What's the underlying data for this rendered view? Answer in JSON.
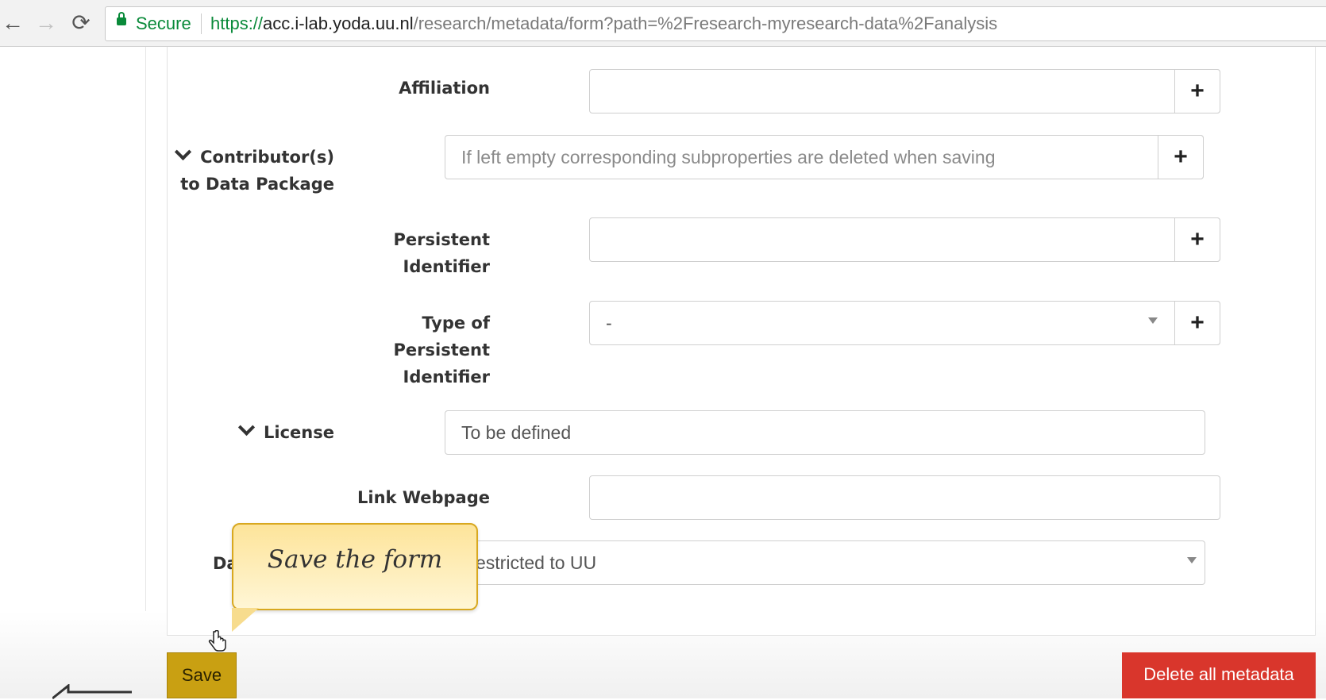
{
  "browser": {
    "secure_label": "Secure",
    "url_protocol": "https://",
    "url_host": "acc.i-lab.yoda.uu.nl",
    "url_path": "/research/metadata/form?path=%2Fresearch-myresearch-data%2Fanalysis",
    "back_icon": "←",
    "forward_icon": "→",
    "reload_icon": "⟳"
  },
  "form": {
    "affiliation": {
      "label": "Affiliation",
      "value": "",
      "add_label": "+"
    },
    "contributors": {
      "label_line1": "Contributor(s)",
      "label_line2": "to Data Package",
      "placeholder": "If left empty corresponding subproperties are deleted when saving",
      "add_label": "+"
    },
    "persistent_identifier": {
      "label_line1": "Persistent",
      "label_line2": "Identifier",
      "value": "",
      "add_label": "+"
    },
    "type_of_persistent_identifier": {
      "label_line1": "Type of",
      "label_line2": "Persistent",
      "label_line3": "Identifier",
      "value": "-",
      "add_label": "+"
    },
    "license": {
      "label": "License",
      "value": "To be defined"
    },
    "link_webpage": {
      "label": "Link Webpage",
      "value": ""
    },
    "data_access": {
      "label_visible": "Da",
      "value_visible": "estricted to UU"
    }
  },
  "tooltip": {
    "text": "Save the form"
  },
  "buttons": {
    "save": "Save",
    "delete": "Delete all metadata"
  },
  "colors": {
    "save": "#c9a012",
    "delete": "#d9362c",
    "tooltip": "#fde49a",
    "secure": "#0a8a3a"
  }
}
